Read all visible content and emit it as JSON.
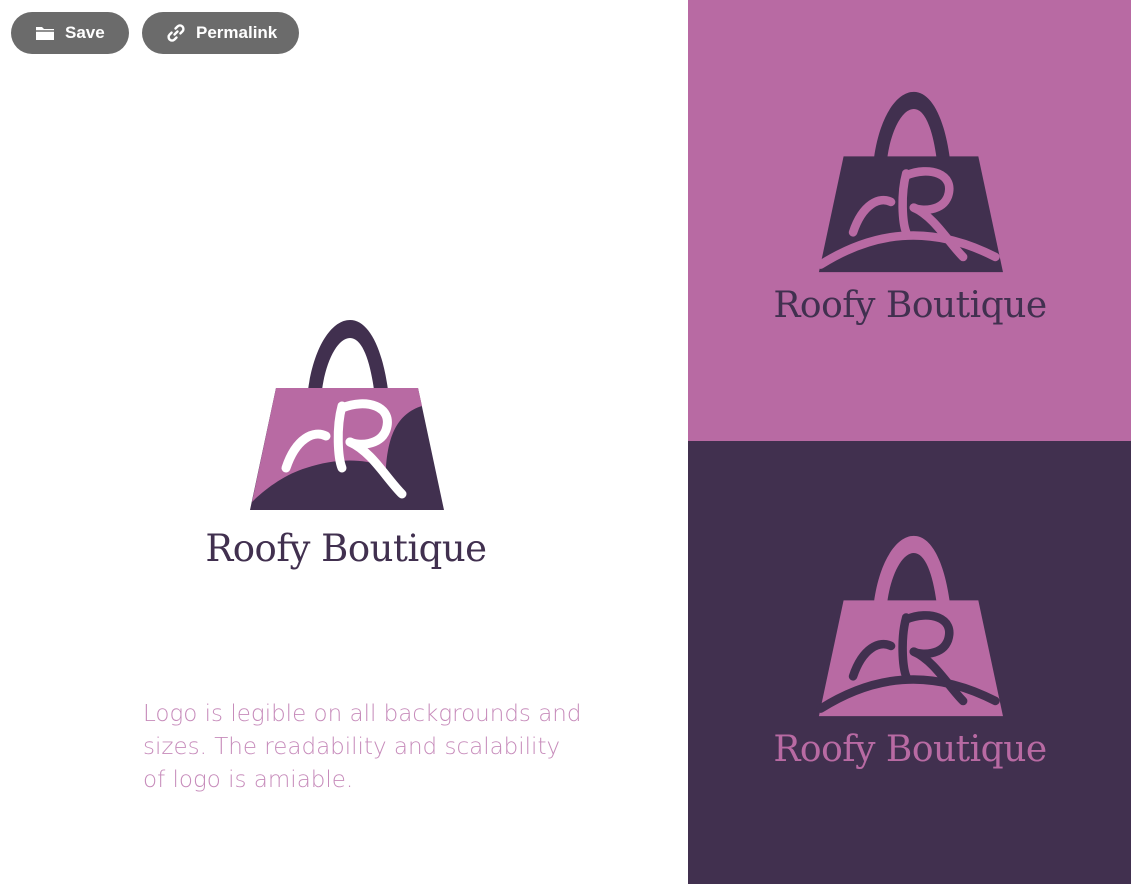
{
  "toolbar": {
    "save_label": "Save",
    "save_icon": "folder-icon",
    "permalink_label": "Permalink",
    "permalink_icon": "link-icon"
  },
  "logo": {
    "brand_name": "Roofy Boutique",
    "monogram": "R",
    "icon": "shopping-bag-icon"
  },
  "tagline": "Logo is legible on all backgrounds and sizes. The readability and scalability of logo is amiable.",
  "colors": {
    "pink": "#b86aa3",
    "dark_purple": "#41304f",
    "tagline_text": "#c78cbb",
    "button_bg": "#6b6b6b",
    "background": "#ffffff"
  }
}
